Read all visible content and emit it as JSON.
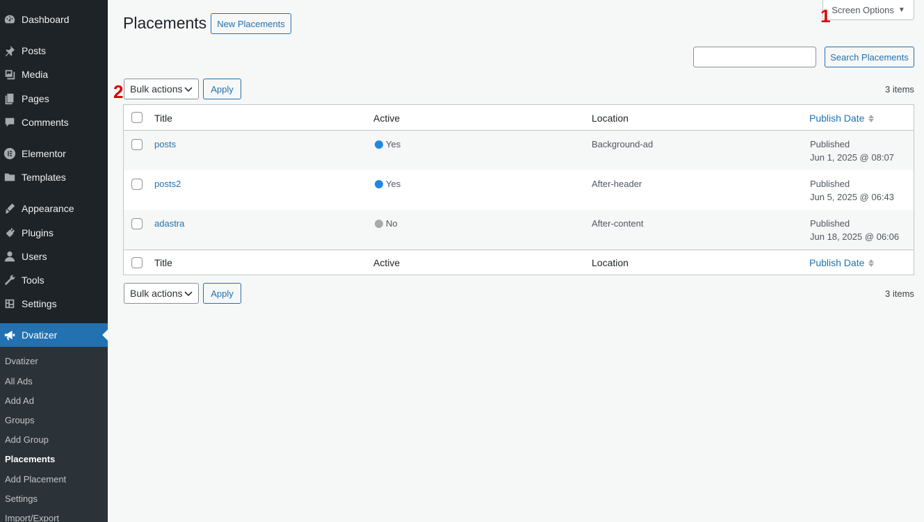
{
  "sidebar": {
    "menu": [
      {
        "label": "Dashboard",
        "icon": "dashboard-icon"
      },
      {
        "label": "Posts",
        "icon": "pin-icon"
      },
      {
        "label": "Media",
        "icon": "media-icon"
      },
      {
        "label": "Pages",
        "icon": "pages-icon"
      },
      {
        "label": "Comments",
        "icon": "comment-icon"
      },
      {
        "label": "Elementor",
        "icon": "elementor-icon"
      },
      {
        "label": "Templates",
        "icon": "folder-icon"
      },
      {
        "label": "Appearance",
        "icon": "brush-icon"
      },
      {
        "label": "Plugins",
        "icon": "plugin-icon"
      },
      {
        "label": "Users",
        "icon": "user-icon"
      },
      {
        "label": "Tools",
        "icon": "wrench-icon"
      },
      {
        "label": "Settings",
        "icon": "settings-icon"
      },
      {
        "label": "Dvatizer",
        "icon": "megaphone-icon"
      }
    ],
    "submenu": [
      "Dvatizer",
      "All Ads",
      "Add Ad",
      "Groups",
      "Add Group",
      "Placements",
      "Add Placement",
      "Settings",
      "Import/Export"
    ]
  },
  "header": {
    "title": "Placements",
    "new_button": "New Placements",
    "screen_options": "Screen Options",
    "screen_options_arrow": "▼"
  },
  "markers": {
    "one": "1",
    "two": "2"
  },
  "search": {
    "button": "Search Placements",
    "value": ""
  },
  "bulk": {
    "label": "Bulk actions",
    "apply": "Apply"
  },
  "items_count": "3 items",
  "table": {
    "columns": {
      "title": "Title",
      "active": "Active",
      "location": "Location",
      "publish_date": "Publish Date"
    },
    "rows": [
      {
        "title": "posts",
        "active": "Yes",
        "active_color": "#1e88e5",
        "location": "Background-ad",
        "status": "Published",
        "date": "Jun 1, 2025 @ 08:07"
      },
      {
        "title": "posts2",
        "active": "Yes",
        "active_color": "#1e88e5",
        "location": "After-header",
        "status": "Published",
        "date": "Jun 5, 2025 @ 06:43"
      },
      {
        "title": "adastra",
        "active": "No",
        "active_color": "#a7aaad",
        "location": "After-content",
        "status": "Published",
        "date": "Jun 18, 2025 @ 06:06"
      }
    ]
  },
  "colors": {
    "accent": "#2271b1",
    "sidebar": "#1d2327",
    "marker": "#dd0000"
  }
}
